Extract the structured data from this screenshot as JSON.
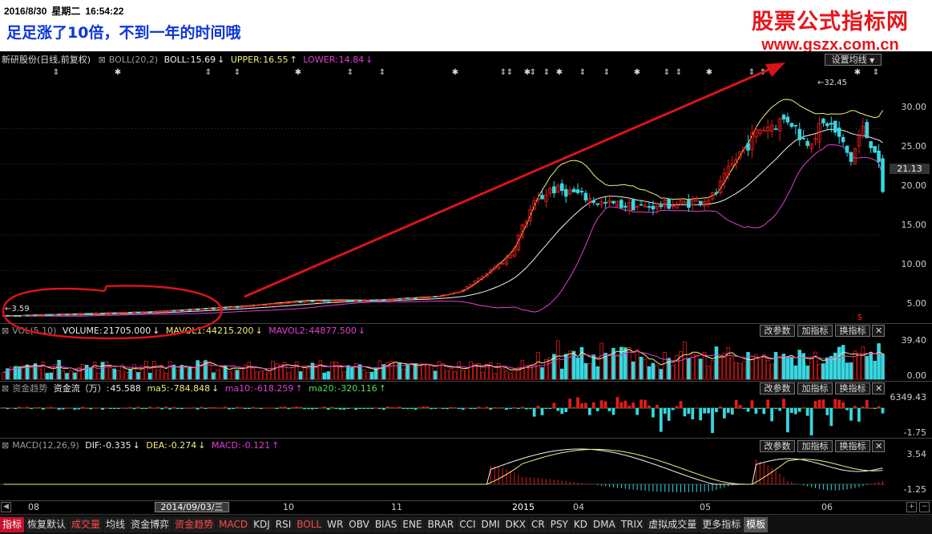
{
  "banner": {
    "date": "2016/8/30",
    "weekday": "星期二",
    "time": "16:54:22",
    "caption": "足足涨了10倍，不到一年的时间哦",
    "brand_name": "股票公式指标网",
    "brand_url": "www.gszx.com.cn"
  },
  "colors": {
    "red": "#e81a1a",
    "cyan": "#37d7e1",
    "yellow": "#f1ef7a",
    "magenta": "#e43fd6",
    "white": "#f2f2f2",
    "annot": "#d8141a"
  },
  "main": {
    "stock": "新研股份",
    "period": "(日线,前复权)",
    "indicator": "BOLL(20,2)",
    "boll_label": "BOLL:",
    "boll_value": "15.69",
    "upper_label": "UPPER:",
    "upper_value": "16.55",
    "lower_label": "LOWER:",
    "lower_value": "14.84",
    "setup_button": "设置均线",
    "y_ticks": [
      "30.00",
      "25.00",
      "20.00",
      "15.00",
      "10.00",
      "5.00"
    ],
    "current_price": "21.13",
    "low_label": "3.59",
    "high_label": "32.45",
    "signal_glyph": "$"
  },
  "vol": {
    "title": "VOL(5,10)",
    "volume_label": "VOLUME:",
    "volume_value": "21705.000",
    "mavol1_label": "MAVOL1:",
    "mavol1_value": "44215.200",
    "mavol2_label": "MAVOL2:",
    "mavol2_value": "44877.500",
    "y_ticks": [
      "39.40",
      "0.00"
    ]
  },
  "fund": {
    "title": "资金趋势",
    "flow_label": "资金流（万）:",
    "flow_value": "45.588",
    "ma5_label": "ma5:",
    "ma5_value": "-784.848",
    "ma10_label": "ma10:",
    "ma10_value": "-618.259",
    "ma20_label": "ma20:",
    "ma20_value": "-320.116",
    "y_ticks": [
      "6349.43",
      "-1.75"
    ]
  },
  "macd": {
    "title": "MACD(12,26,9)",
    "dif_label": "DIF:",
    "dif_value": "-0.335",
    "dea_label": "DEA:",
    "dea_value": "-0.274",
    "macd_label": "MACD:",
    "macd_value": "-0.121",
    "y_ticks": [
      "3.54",
      "-1.25"
    ]
  },
  "panel_buttons": {
    "params": "改参数",
    "add": "加指标",
    "swap": "换指标",
    "close": "✕"
  },
  "xaxis": {
    "labels": [
      "08",
      "09",
      "10",
      "11",
      "2015",
      "04",
      "05",
      "06"
    ],
    "selected_date": "2014/09/03/三"
  },
  "tabs": [
    "指标",
    "恢复默认",
    "成交量",
    "均线",
    "资金博弈",
    "资金趋势",
    "MACD",
    "KDJ",
    "RSI",
    "BOLL",
    "WR",
    "OBV",
    "BIAS",
    "ENE",
    "BRAR",
    "CCI",
    "DMI",
    "DKX",
    "CR",
    "PSY",
    "KD",
    "DMA",
    "TRIX",
    "虚拟成交量",
    "更多指标",
    "模板"
  ],
  "chart_data": {
    "type": "candlestick",
    "start_price": 3.59,
    "peak_price": 32.45,
    "last_price": 21.13,
    "ylim": [
      2.8,
      38.2
    ],
    "daily_bars": 223,
    "y_ticks": [
      30,
      25,
      20,
      15,
      10,
      5
    ]
  }
}
